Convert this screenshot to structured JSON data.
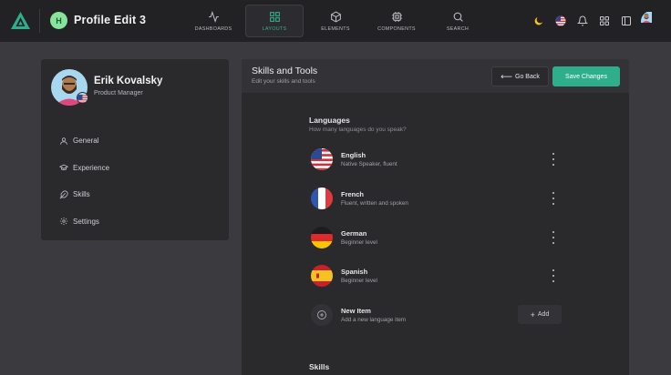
{
  "header": {
    "project_initial": "H",
    "project_title": "Profile Edit 3",
    "nav": [
      {
        "label": "DASHBOARDS",
        "icon": "activity-icon"
      },
      {
        "label": "LAYOUTS",
        "icon": "grid-icon",
        "active": true
      },
      {
        "label": "ELEMENTS",
        "icon": "cube-icon"
      },
      {
        "label": "COMPONENTS",
        "icon": "cpu-icon"
      },
      {
        "label": "SEARCH",
        "icon": "search-icon"
      }
    ],
    "right_icons": [
      "moon-icon",
      "us-flag-icon",
      "bell-icon",
      "apps-grid-icon",
      "sidebar-toggle-icon"
    ]
  },
  "profile": {
    "name": "Erik Kovalsky",
    "role": "Product Manager",
    "menu": [
      {
        "label": "General",
        "icon": "user-icon"
      },
      {
        "label": "Experience",
        "icon": "graduation-cap-icon"
      },
      {
        "label": "Skills",
        "icon": "feather-icon"
      },
      {
        "label": "Settings",
        "icon": "gear-icon"
      }
    ]
  },
  "panel": {
    "title": "Skills and Tools",
    "subtitle": "Edit your skills and tools",
    "back_label": "Go Back",
    "save_label": "Save Changes"
  },
  "languages": {
    "title": "Languages",
    "subtitle": "How many languages do you speak?",
    "items": [
      {
        "name": "English",
        "level": "Native Speaker, fluent",
        "flag": "us-flag"
      },
      {
        "name": "French",
        "level": "Fluent, written and spoken",
        "flag": "fr-flag"
      },
      {
        "name": "German",
        "level": "Beginner level",
        "flag": "de-flag"
      },
      {
        "name": "Spanish",
        "level": "Beginner level",
        "flag": "es-flag"
      }
    ],
    "new_item": {
      "name": "New Item",
      "hint": "Add a new language item",
      "add_label": "Add"
    }
  },
  "skills": {
    "title": "Skills"
  },
  "colors": {
    "accent": "#2fae8b",
    "topbar": "#222225",
    "background": "#3b3b3f",
    "card": "#2a2a2d"
  }
}
